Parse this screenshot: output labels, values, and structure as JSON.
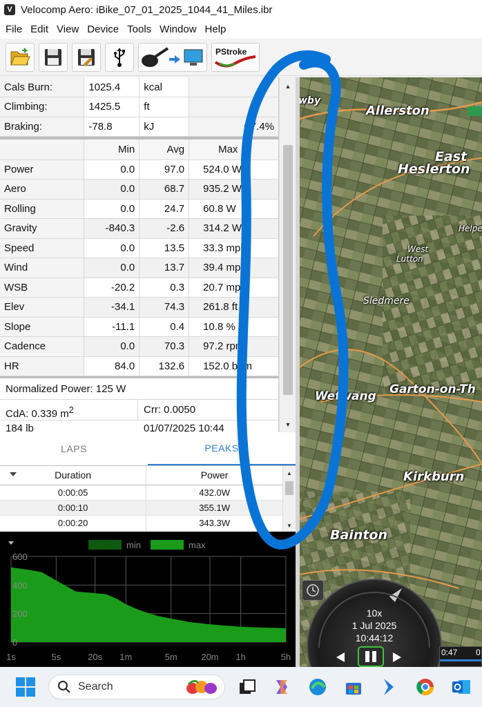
{
  "window": {
    "title": "Velocomp Aero: iBike_07_01_2025_1044_41_Miles.ibr",
    "app_icon_letter": "V"
  },
  "menu": [
    "File",
    "Edit",
    "View",
    "Device",
    "Tools",
    "Window",
    "Help"
  ],
  "toolbar": {
    "pstroke_label": "PStroke"
  },
  "summary": [
    {
      "label": "Cals Burn:",
      "value": "1025.4",
      "unit": "kcal",
      "extra": ""
    },
    {
      "label": "Climbing:",
      "value": "1425.5",
      "unit": "ft",
      "extra": ""
    },
    {
      "label": "Braking:",
      "value": "-78.8",
      "unit": "kJ",
      "extra": "(-7.4%"
    }
  ],
  "stats": {
    "headers": [
      "",
      "Min",
      "Avg",
      "Max"
    ],
    "rows": [
      {
        "label": "Power",
        "min": "0.0",
        "avg": "97.0",
        "max": "524.0 W"
      },
      {
        "label": "Aero",
        "min": "0.0",
        "avg": "68.7",
        "max": "935.2 W"
      },
      {
        "label": "Rolling",
        "min": "0.0",
        "avg": "24.7",
        "max": "60.8 W"
      },
      {
        "label": "Gravity",
        "min": "-840.3",
        "avg": "-2.6",
        "max": "314.2 W"
      },
      {
        "label": "Speed",
        "min": "0.0",
        "avg": "13.5",
        "max": "33.3 mph"
      },
      {
        "label": "Wind",
        "min": "0.0",
        "avg": "13.7",
        "max": "39.4 mph"
      },
      {
        "label": "WSB",
        "min": "-20.2",
        "avg": "0.3",
        "max": "20.7 mph"
      },
      {
        "label": "Elev",
        "min": "-34.1",
        "avg": "74.3",
        "max": "261.8 ft"
      },
      {
        "label": "Slope",
        "min": "-11.1",
        "avg": "0.4",
        "max": "10.8 %"
      },
      {
        "label": "Cadence",
        "min": "0.0",
        "avg": "70.3",
        "max": "97.2 rpm"
      },
      {
        "label": "HR",
        "min": "84.0",
        "avg": "132.6",
        "max": "152.0 bpm"
      }
    ]
  },
  "normalized_power": "Normalized Power: 125 W",
  "cda_prefix": "CdA: 0.339 m",
  "cda_sup": "2",
  "crr": "Crr: 0.0050",
  "weight": "184 lb",
  "date_cell": "01/07/2025  10:44",
  "tabs": {
    "laps": "LAPS",
    "peaks": "PEAKS"
  },
  "peaks": {
    "headers": [
      "Duration",
      "Power"
    ],
    "rows": [
      {
        "duration": "0:00:05",
        "power": "432.0W"
      },
      {
        "duration": "0:00:10",
        "power": "355.1W"
      },
      {
        "duration": "0:00:20",
        "power": "343.3W"
      }
    ]
  },
  "chart_data": {
    "type": "area",
    "title": "",
    "xlabel": "",
    "ylabel": "",
    "x_ticks": [
      "1s",
      "5s",
      "20s",
      "1m",
      "5m",
      "20m",
      "1h",
      "5h"
    ],
    "y_ticks": [
      "0",
      "200",
      "400",
      "600"
    ],
    "ylim": [
      0,
      600
    ],
    "legend": [
      "min",
      "max"
    ],
    "legend_placement": "top-center",
    "grid": true,
    "x_seconds": [
      1,
      2,
      3,
      5,
      8,
      10,
      15,
      20,
      30,
      45,
      60,
      90,
      120,
      180,
      300,
      600,
      1200,
      1800,
      3600,
      7200,
      18000
    ],
    "series": [
      {
        "name": "max",
        "color": "#1a9c1a",
        "values": [
          524,
          505,
          490,
          432,
          380,
          355,
          348,
          343,
          335,
          300,
          265,
          230,
          210,
          185,
          165,
          140,
          125,
          118,
          108,
          102,
          98
        ]
      }
    ]
  },
  "map": {
    "towns": [
      "Allerston",
      "East",
      "Heslerton",
      "Helperth",
      "West",
      "Lutton",
      "Sledmere",
      "Wetwang",
      "Garton-on-Th",
      "Kirkburn",
      "Bainton",
      "wby"
    ],
    "route_color": "#0a74d6"
  },
  "player": {
    "speed": "10x",
    "date": "1 Jul 2025",
    "time": "10:44:12",
    "timeline_a": "0:47",
    "timeline_b": "0"
  },
  "taskbar": {
    "search_label": "Search"
  }
}
